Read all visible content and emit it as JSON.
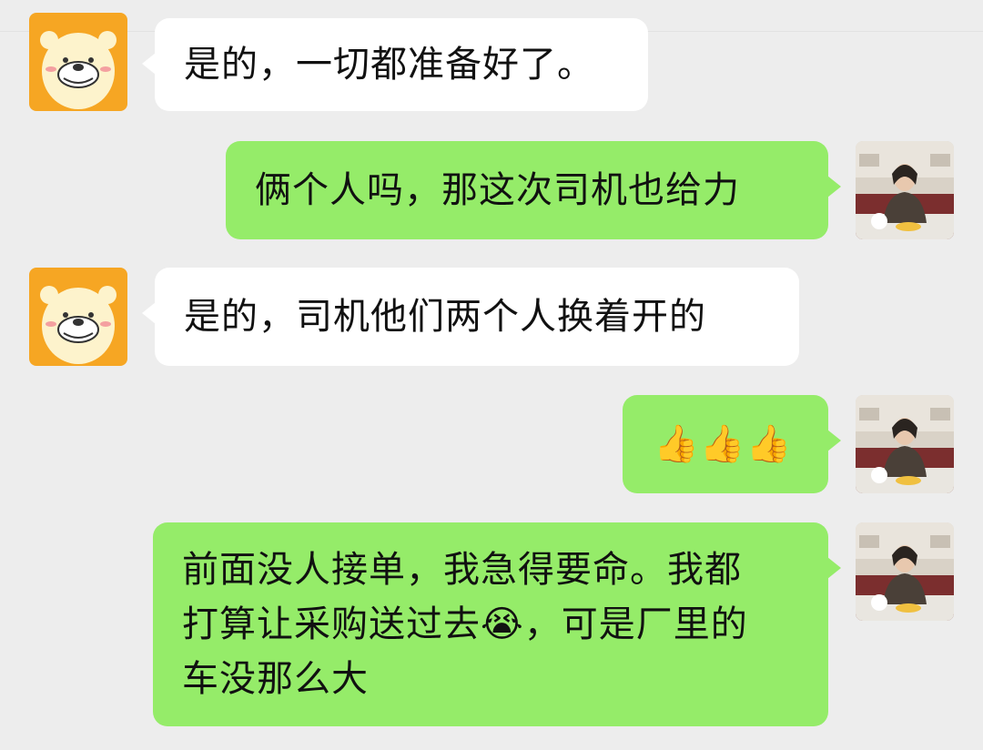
{
  "colors": {
    "background": "#ededed",
    "incoming_bubble": "#ffffff",
    "outgoing_bubble": "#95ec69"
  },
  "messages": [
    {
      "side": "incoming",
      "avatar": "bear-avatar",
      "text": "是的，一切都准备好了。"
    },
    {
      "side": "outgoing",
      "avatar": "user-photo-avatar",
      "text": "俩个人吗，那这次司机也给力"
    },
    {
      "side": "incoming",
      "avatar": "bear-avatar",
      "text": "是的，司机他们两个人换着开的"
    },
    {
      "side": "outgoing",
      "avatar": "user-photo-avatar",
      "emoji_text": "👍👍👍",
      "emoji_name": "thumbs-up-icon"
    },
    {
      "side": "outgoing",
      "avatar": "user-photo-avatar",
      "lines": [
        "前面没人接单，我急得要命。我都",
        "打算让采购送过去",
        "，可是厂里的",
        "车没那么大"
      ],
      "inline_emoji": "😭",
      "inline_emoji_name": "crying-laughing-icon"
    }
  ]
}
